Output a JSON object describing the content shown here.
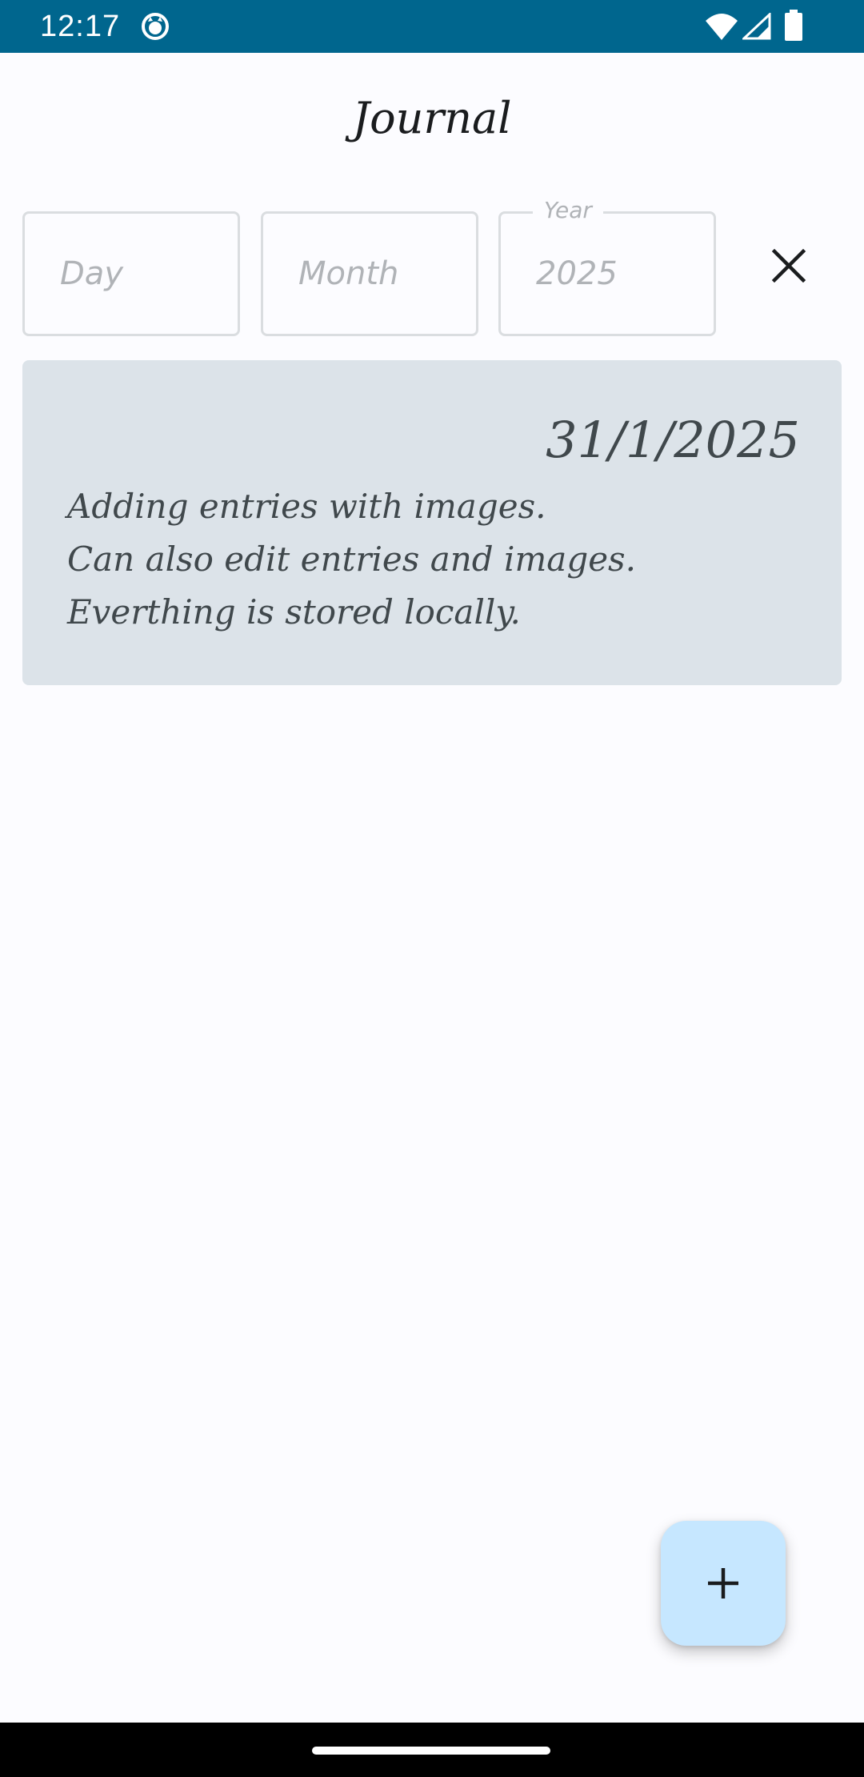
{
  "status_bar": {
    "time": "12:17",
    "background_color": "#00668E",
    "icons": [
      "app-notification-icon",
      "wifi-icon",
      "signal-icon",
      "battery-icon"
    ]
  },
  "header": {
    "title": "Journal"
  },
  "filters": {
    "day": {
      "placeholder": "Day",
      "value": ""
    },
    "month": {
      "placeholder": "Month",
      "value": ""
    },
    "year": {
      "label": "Year",
      "value": "2025"
    },
    "clear_icon": "close-icon"
  },
  "entries": [
    {
      "date": "31/1/2025",
      "lines": [
        "Adding entries with images.",
        "Can also edit entries and images.",
        "Everthing is stored locally."
      ],
      "background_color": "#DCE3E9"
    }
  ],
  "fab": {
    "icon": "add-icon",
    "background_color": "#C6E7FF"
  },
  "nav_bar": {
    "background_color": "#000000"
  }
}
